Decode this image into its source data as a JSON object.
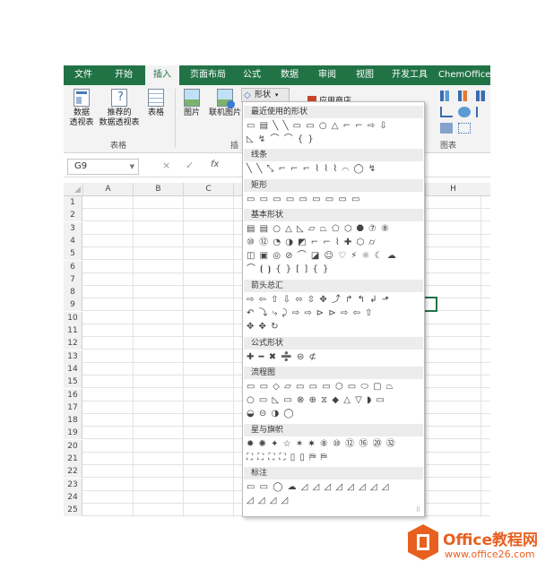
{
  "ribbon_tabs": [
    "文件",
    "开始",
    "插入",
    "页面布局",
    "公式",
    "数据",
    "审阅",
    "视图",
    "开发工具",
    "ChemOffice"
  ],
  "active_tab": "插入",
  "ribbon": {
    "pivot_table": "数据\n透视表",
    "recommended_pivot": "推荐的\n数据透视表",
    "table": "表格",
    "tables_group": "表格",
    "picture": "图片",
    "online_picture": "联机图片",
    "illustrations_group_partial": "插",
    "shapes_button": "形状",
    "app_store": "应用商店",
    "charts_group": "图表"
  },
  "formula_bar": {
    "name_box": "G9",
    "cancel": "×",
    "enter": "✓",
    "fx": "fx"
  },
  "columns": [
    "A",
    "B",
    "C",
    "H"
  ],
  "rows": [
    "1",
    "2",
    "3",
    "4",
    "5",
    "6",
    "7",
    "8",
    "9",
    "10",
    "11",
    "12",
    "13",
    "14",
    "15",
    "16",
    "17",
    "18",
    "19",
    "20",
    "21",
    "22",
    "23",
    "24",
    "25"
  ],
  "selected_cell": "G9",
  "shapes_menu": {
    "sections": [
      {
        "title": "最近使用的形状",
        "rows": [
          "▭ ▤ ╲ ╲ ▭ ▭ ○ △ ⌐ ⌐ ⇨ ⇩",
          "◺ ↯ ⌒ ⌒ { }"
        ]
      },
      {
        "title": "线条",
        "rows": [
          "╲ ╲ ⤡ ⌐ ⌐ ⌐ ⌇ ⌇ ⌇ ⌒ ◯ ↯"
        ]
      },
      {
        "title": "矩形",
        "rows": [
          "▭ ▭ ▭ ▭ ▭ ▭ ▭ ▭ ▭"
        ]
      },
      {
        "title": "基本形状",
        "rows": [
          "▤ ▤ ○ △ ◺ ▱ ⏢ ⬠ ⬡ ⯃ ⑦ ⑧",
          "⑩ ⑫ ◔ ◑ ◩ ⌐ ⌐ ⌇ ✚ ⬡ ⌭",
          "◫ ▣ ◎ ⊘ ⌒ ◪ ☺ ♡ ⚡ ☼ ☾ ☁",
          "⌒ ⦗ ⦘ { } [ ] { }"
        ]
      },
      {
        "title": "箭头总汇",
        "rows": [
          "⇨ ⇦ ⇧ ⇩ ⬄ ⇳ ✥ ⤴ ↱ ↰ ↲ ⬏",
          "↶ ⤵ ⤷ ⤸ ⇨ ⇨ ⊳ ⊳ ⇨ ⇦ ⇧",
          "✥ ✥ ↻"
        ]
      },
      {
        "title": "公式形状",
        "rows": [
          "✚ ━ ✖ ➗ ⊜ ⊄"
        ]
      },
      {
        "title": "流程图",
        "rows": [
          "▭ ▭ ◇ ▱ ▭ ▭ ▭ ⬡ ▭ ⬭ ▢ ⏢",
          "○ ▭ ◺ ▭ ⊗ ⊕ ⧖ ◆ △ ▽ ◗ ▭",
          "◒ ⊝ ◑ ◯"
        ]
      },
      {
        "title": "星与旗帜",
        "rows": [
          "✹ ✺ ✦ ☆ ✶ ✷ ⑧ ⑩ ⑫ ⑯ ⑳ ㉜",
          "⛶ ⛶ ⛶ ⛶ ▯ ▯ ⛿ ⛿"
        ]
      },
      {
        "title": "标注",
        "rows": [
          "▭ ▭ ◯ ☁ ◿ ◿ ◿ ◿ ◿ ◿ ◿ ◿",
          "◿ ◿ ◿ ◿"
        ]
      }
    ]
  },
  "watermark": {
    "name": "Office教程网",
    "url": "www.office26.com"
  },
  "colors": {
    "brand_green": "#217346",
    "logo_orange": "#e8601f"
  }
}
